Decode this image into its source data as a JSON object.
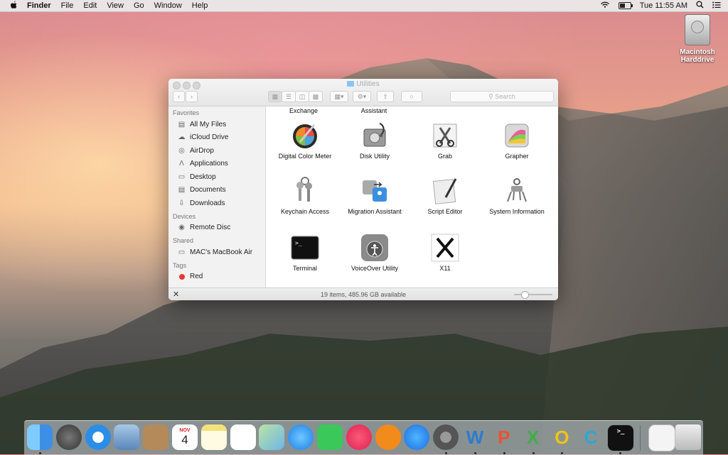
{
  "menubar": {
    "apple_icon": "apple-logo",
    "app_name": "Finder",
    "menus": [
      "File",
      "Edit",
      "View",
      "Go",
      "Window",
      "Help"
    ],
    "clock": "Tue 11:55 AM",
    "battery_level": 0.5
  },
  "desktop": {
    "drive_label_line1": "Macintosh",
    "drive_label_line2": "Harddrive"
  },
  "window": {
    "title": "Utilities",
    "search_placeholder": "Search",
    "status": "19 items, 485.96 GB available",
    "icon_size_level": 0.2
  },
  "sidebar": {
    "favorites_header": "Favorites",
    "favorites": [
      {
        "label": "All My Files",
        "icon": "all-files-icon"
      },
      {
        "label": "iCloud Drive",
        "icon": "cloud-icon"
      },
      {
        "label": "AirDrop",
        "icon": "airdrop-icon"
      },
      {
        "label": "Applications",
        "icon": "applications-icon"
      },
      {
        "label": "Desktop",
        "icon": "desktop-icon"
      },
      {
        "label": "Documents",
        "icon": "documents-icon"
      },
      {
        "label": "Downloads",
        "icon": "downloads-icon"
      }
    ],
    "devices_header": "Devices",
    "devices": [
      {
        "label": "Remote Disc",
        "icon": "disc-icon"
      }
    ],
    "shared_header": "Shared",
    "shared": [
      {
        "label": "MAC's MacBook Air",
        "icon": "laptop-icon"
      }
    ],
    "tags_header": "Tags",
    "tags": [
      {
        "label": "Red",
        "color": "#e53935"
      }
    ]
  },
  "content": {
    "partial_labels": [
      "Exchange",
      "Assistant"
    ],
    "items": [
      {
        "label": "Digital Color Meter",
        "icon": "color-meter-icon"
      },
      {
        "label": "Disk Utility",
        "icon": "disk-utility-icon"
      },
      {
        "label": "Grab",
        "icon": "grab-icon"
      },
      {
        "label": "Grapher",
        "icon": "grapher-icon"
      },
      {
        "label": "Keychain Access",
        "icon": "keychain-icon"
      },
      {
        "label": "Migration Assistant",
        "icon": "migration-icon"
      },
      {
        "label": "Script Editor",
        "icon": "script-editor-icon"
      },
      {
        "label": "System Information",
        "icon": "system-info-icon"
      },
      {
        "label": "Terminal",
        "icon": "terminal-icon"
      },
      {
        "label": "VoiceOver Utility",
        "icon": "voiceover-icon"
      },
      {
        "label": "X11",
        "icon": "x11-icon"
      }
    ]
  },
  "dock": {
    "items": [
      {
        "name": "finder",
        "running": true
      },
      {
        "name": "launchpad",
        "running": false
      },
      {
        "name": "safari",
        "running": false
      },
      {
        "name": "mail",
        "running": false
      },
      {
        "name": "contacts",
        "running": false
      },
      {
        "name": "calendar",
        "running": false,
        "month": "NOV",
        "day": "4"
      },
      {
        "name": "notes",
        "running": false
      },
      {
        "name": "reminders",
        "running": false
      },
      {
        "name": "maps",
        "running": false
      },
      {
        "name": "messages",
        "running": false
      },
      {
        "name": "facetime",
        "running": false
      },
      {
        "name": "itunes",
        "running": false
      },
      {
        "name": "ibooks",
        "running": false
      },
      {
        "name": "app-store",
        "running": false
      },
      {
        "name": "system-preferences",
        "running": true
      },
      {
        "name": "word",
        "running": true,
        "glyph": "W",
        "color": "#2b7cd3"
      },
      {
        "name": "powerpoint",
        "running": true,
        "glyph": "P",
        "color": "#e8542f"
      },
      {
        "name": "excel",
        "running": true,
        "glyph": "X",
        "color": "#3fae49"
      },
      {
        "name": "outlook",
        "running": true,
        "glyph": "O",
        "color": "#f2c40f"
      },
      {
        "name": "c-app",
        "running": false,
        "glyph": "C",
        "color": "#29a8d8"
      },
      {
        "name": "terminal",
        "running": true
      }
    ],
    "trash_name": "trash"
  }
}
